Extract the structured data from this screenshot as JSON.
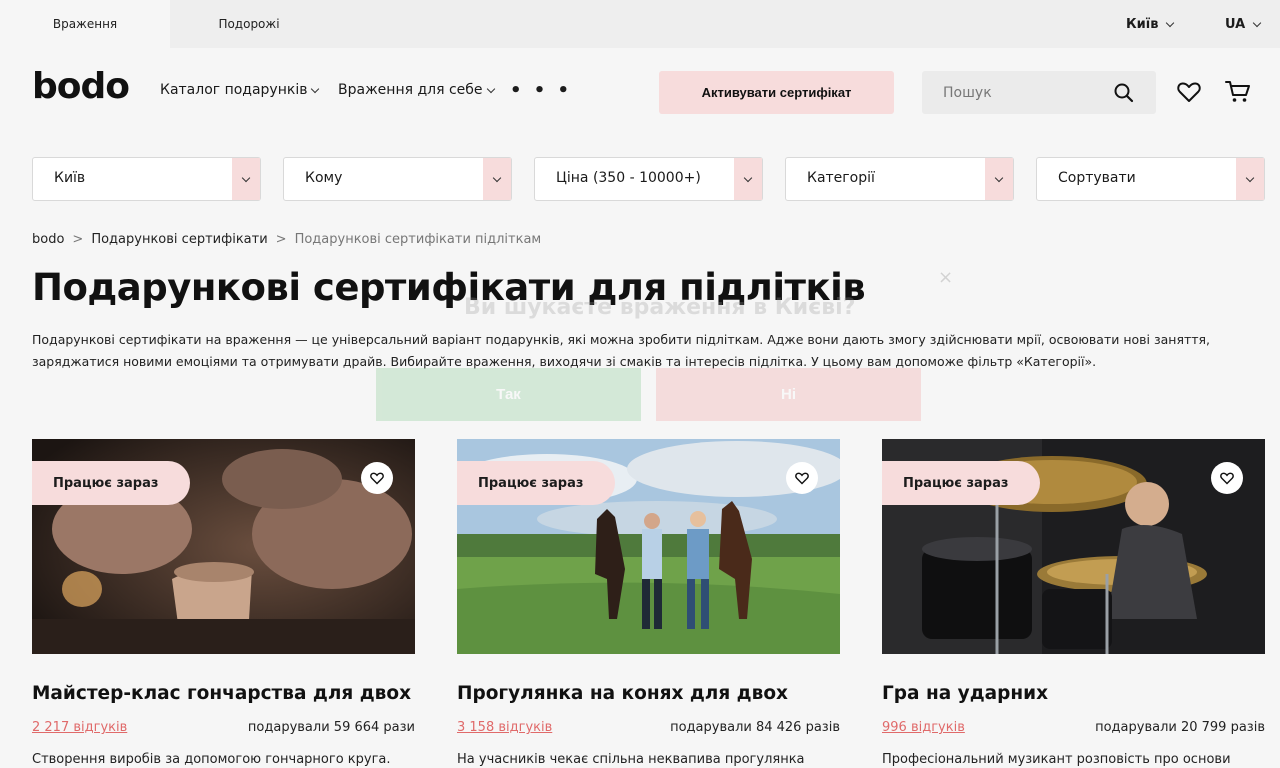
{
  "topbar": {
    "tabs": [
      {
        "label": "Враження"
      },
      {
        "label": "Подорожі"
      }
    ],
    "city": "Київ",
    "language": "UA"
  },
  "header": {
    "logo": "bodo",
    "nav": [
      {
        "label": "Каталог подарунків"
      },
      {
        "label": "Враження для себе"
      }
    ],
    "more": "• • •",
    "activate_label": "Активувати сертифікат",
    "search_placeholder": "Пошук"
  },
  "filters": [
    {
      "label": "Київ"
    },
    {
      "label": "Кому"
    },
    {
      "label": "Ціна (350 - 10000+)"
    },
    {
      "label": "Категорії"
    },
    {
      "label": "Сортувати"
    }
  ],
  "breadcrumb": [
    {
      "label": "bodo"
    },
    {
      "label": "Подарункові сертифікати"
    },
    {
      "label": "Подарункові сертифікати підліткам"
    }
  ],
  "page": {
    "title": "Подарункові сертифікати для підлітків",
    "description": "Подарункові сертифікати на враження — це універсальний варіант подарунків, які можна зробити підліткам. Адже вони дають змогу здійснювати мрії, освоювати нові заняття, заряджатися новими емоціями та отримувати драйв. Вибирайте враження, виходячи зі смаків та інтересів підлітка. У цьому вам допоможе фільтр «Категорії»."
  },
  "popup": {
    "question": "Ви шукаєте враження в Києві?",
    "yes": "Так",
    "no": "Ні",
    "close": "×"
  },
  "cards": [
    {
      "badge": "Працює зараз",
      "title": "Майстер-клас гончарства для двох",
      "reviews": "2 217 відгуків",
      "gifted": "подарували 59 664 рази",
      "description": "Створення виробів за допомогою гончарного круга."
    },
    {
      "badge": "Працює зараз",
      "title": "Прогулянка на конях для двох",
      "reviews": "3 158 відгуків",
      "gifted": "подарували 84 426 разів",
      "description": "На учасників чекає спільна неквапива прогулянка"
    },
    {
      "badge": "Працює зараз",
      "title": "Гра на ударних",
      "reviews": "996 відгуків",
      "gifted": "подарували 20 799 разів",
      "description": "Професіональний музикант розповість про основи"
    }
  ],
  "colors": {
    "accent_pink": "#f7dcdc",
    "review_link": "#e06a6a",
    "background": "#f6f6f6"
  }
}
